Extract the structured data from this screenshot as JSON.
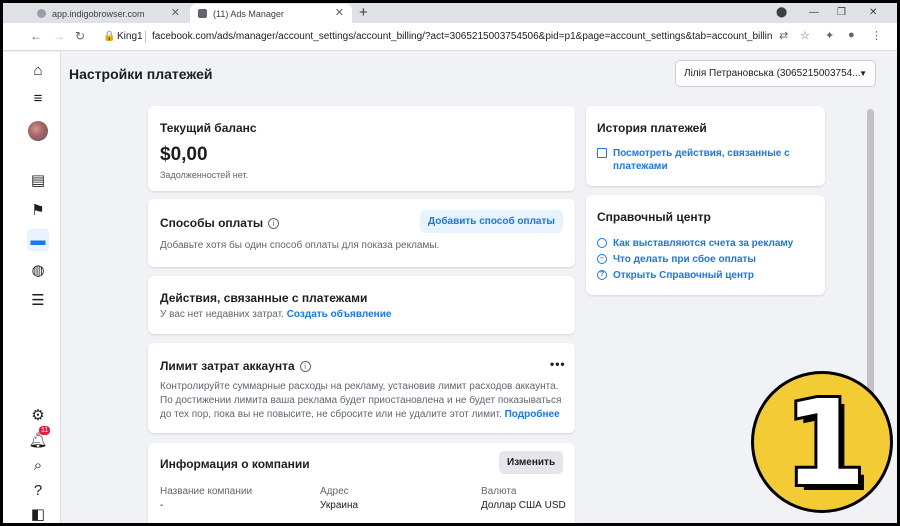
{
  "browser": {
    "tabs": [
      {
        "label": "app.indigobrowser.com"
      },
      {
        "label": "(11) Ads Manager"
      }
    ],
    "profile": "King1",
    "url": "facebook.com/ads/manager/account_settings/account_billing/?act=3065215003754506&pid=p1&page=account_settings&tab=account_billing_s..."
  },
  "rail": {
    "notifications_count": "11"
  },
  "page": {
    "title": "Настройки платежей",
    "account_selector": "Лілія Петрановська (3065215003754..."
  },
  "balance": {
    "heading": "Текущий баланс",
    "amount": "$0,00",
    "note": "Задолженностей нет."
  },
  "payment_methods": {
    "heading": "Способы оплаты",
    "add_button": "Добавить способ оплаты",
    "description": "Добавьте хотя бы один способ оплаты для показа рекламы."
  },
  "payment_activity": {
    "heading": "Действия, связанные с платежами",
    "text": "У вас нет недавних затрат.",
    "link": "Создать объявление"
  },
  "spend_limit": {
    "heading": "Лимит затрат аккаунта",
    "text_line1": "Контролируйте суммарные расходы на рекламу, установив лимит расходов аккаунта.",
    "text_line2": "По достижении лимита ваша реклама будет приостановлена и не будет показываться",
    "text_line3": "до тех пор, пока вы не повысите, не сбросите или не удалите этот лимит.",
    "link": "Подробнее"
  },
  "company": {
    "heading": "Информация о компании",
    "edit_button": "Изменить",
    "columns": [
      {
        "label": "Название компании",
        "value": "-"
      },
      {
        "label": "Адрес",
        "value": "Украина"
      },
      {
        "label": "Валюта",
        "value": "Доллар США USD"
      }
    ]
  },
  "history": {
    "heading": "История платежей",
    "link_line1": "Посмотреть действия, связанные с",
    "link_line2": "платежами"
  },
  "help": {
    "heading": "Справочный центр",
    "links": [
      {
        "label": "Как выставляются счета за рекламу"
      },
      {
        "label": "Что делать при сбое оплаты"
      },
      {
        "label": "Открыть Справочный центр"
      }
    ]
  },
  "overlay": {
    "number": "1",
    "color": "#f2cb35"
  }
}
